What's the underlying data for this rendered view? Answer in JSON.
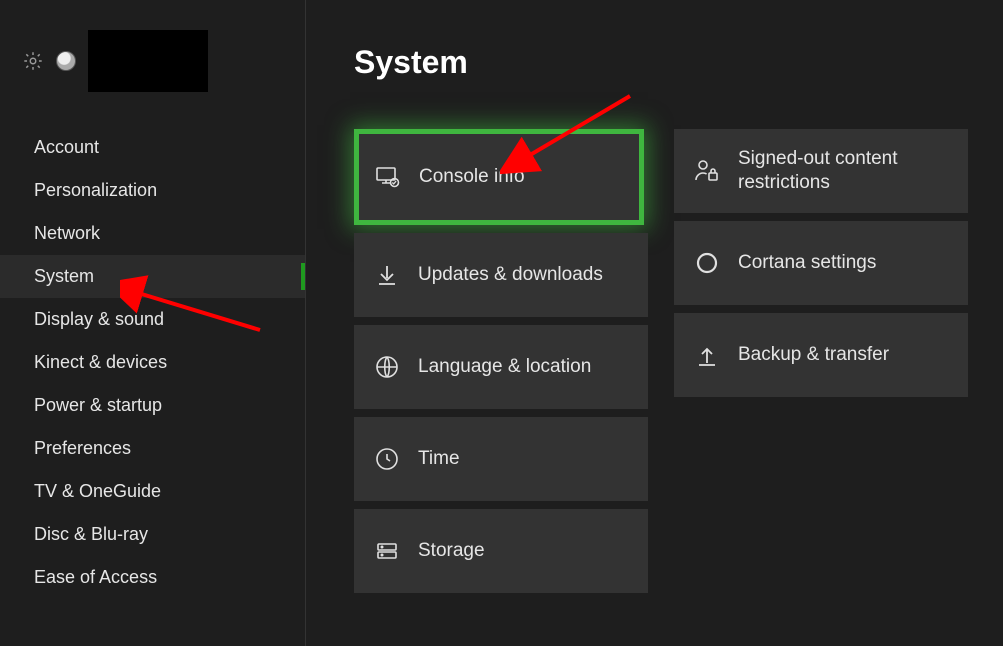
{
  "page": {
    "title": "System"
  },
  "sidebar": {
    "items": [
      {
        "label": "Account"
      },
      {
        "label": "Personalization"
      },
      {
        "label": "Network"
      },
      {
        "label": "System"
      },
      {
        "label": "Display & sound"
      },
      {
        "label": "Kinect & devices"
      },
      {
        "label": "Power & startup"
      },
      {
        "label": "Preferences"
      },
      {
        "label": "TV & OneGuide"
      },
      {
        "label": "Disc & Blu-ray"
      },
      {
        "label": "Ease of Access"
      }
    ],
    "active_index": 3
  },
  "tiles": {
    "col1": [
      {
        "label": "Console info",
        "icon": "console-info-icon",
        "highlight": true
      },
      {
        "label": "Updates & downloads",
        "icon": "download-icon"
      },
      {
        "label": "Language & location",
        "icon": "globe-icon"
      },
      {
        "label": "Time",
        "icon": "clock-icon"
      },
      {
        "label": "Storage",
        "icon": "storage-icon"
      }
    ],
    "col2": [
      {
        "label": "Signed-out content restrictions",
        "icon": "person-lock-icon"
      },
      {
        "label": "Cortana settings",
        "icon": "cortana-icon"
      },
      {
        "label": "Backup & transfer",
        "icon": "transfer-icon"
      }
    ]
  },
  "annotations": {
    "arrow1_target": "sidebar-item-system",
    "arrow2_target": "tile-console-info"
  }
}
